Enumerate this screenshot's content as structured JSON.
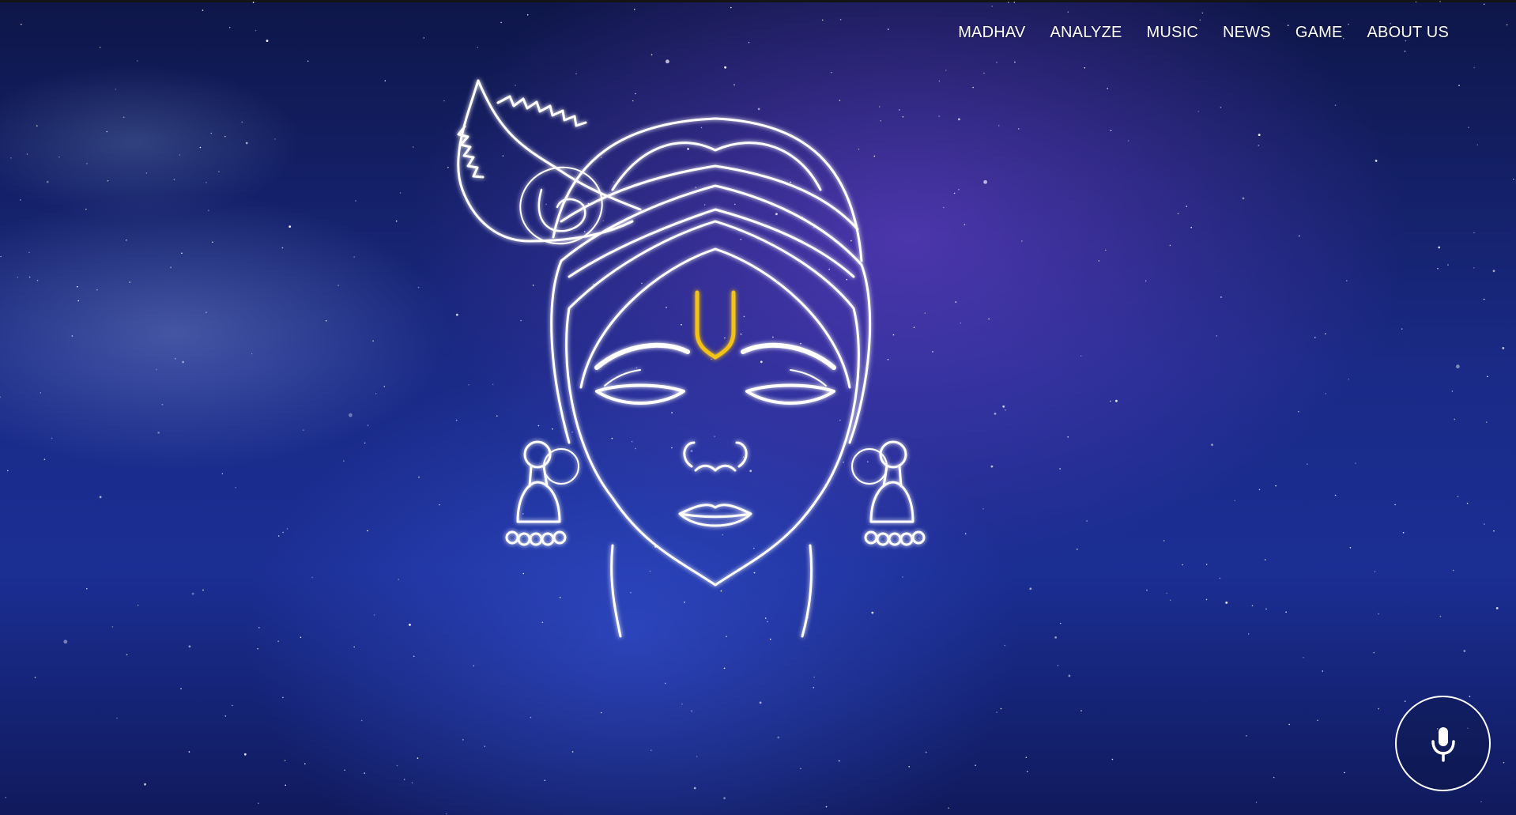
{
  "nav": {
    "items": [
      {
        "label": "MADHAV"
      },
      {
        "label": "ANALYZE"
      },
      {
        "label": "MUSIC"
      },
      {
        "label": "NEWS"
      },
      {
        "label": "GAME"
      },
      {
        "label": "ABOUT US"
      }
    ]
  },
  "hero": {
    "illustration": "krishna-face-line-art",
    "line_color": "#ffffff",
    "tilak_color": "#f2c318"
  },
  "voice": {
    "icon": "microphone-icon"
  },
  "colors": {
    "background": "#1a2a86",
    "accent": "#7a4ad8"
  }
}
